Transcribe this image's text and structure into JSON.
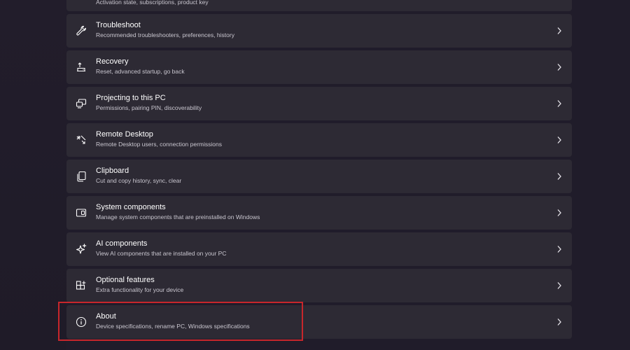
{
  "settings_list": {
    "partial_top_item": {
      "subtitle": "Activation state, subscriptions, product key"
    },
    "items": [
      {
        "title": "Troubleshoot",
        "subtitle": "Recommended troubleshooters, preferences, history",
        "icon": "wrench-icon"
      },
      {
        "title": "Recovery",
        "subtitle": "Reset, advanced startup, go back",
        "icon": "recovery-icon"
      },
      {
        "title": "Projecting to this PC",
        "subtitle": "Permissions, pairing PIN, discoverability",
        "icon": "projecting-icon"
      },
      {
        "title": "Remote Desktop",
        "subtitle": "Remote Desktop users, connection permissions",
        "icon": "remote-desktop-icon"
      },
      {
        "title": "Clipboard",
        "subtitle": "Cut and copy history, sync, clear",
        "icon": "clipboard-icon"
      },
      {
        "title": "System components",
        "subtitle": "Manage system components that are preinstalled on Windows",
        "icon": "system-components-icon"
      },
      {
        "title": "AI components",
        "subtitle": "View AI components that are installed on your PC",
        "icon": "sparkle-icon"
      },
      {
        "title": "Optional features",
        "subtitle": "Extra functionality for your device",
        "icon": "optional-features-icon"
      },
      {
        "title": "About",
        "subtitle": "Device specifications, rename PC, Windows specifications",
        "icon": "info-icon"
      }
    ]
  },
  "colors": {
    "background": "#201c2a",
    "card": "#2d2a34",
    "highlight_border": "#c8262b",
    "subtitle_text": "#c9c6cf"
  }
}
